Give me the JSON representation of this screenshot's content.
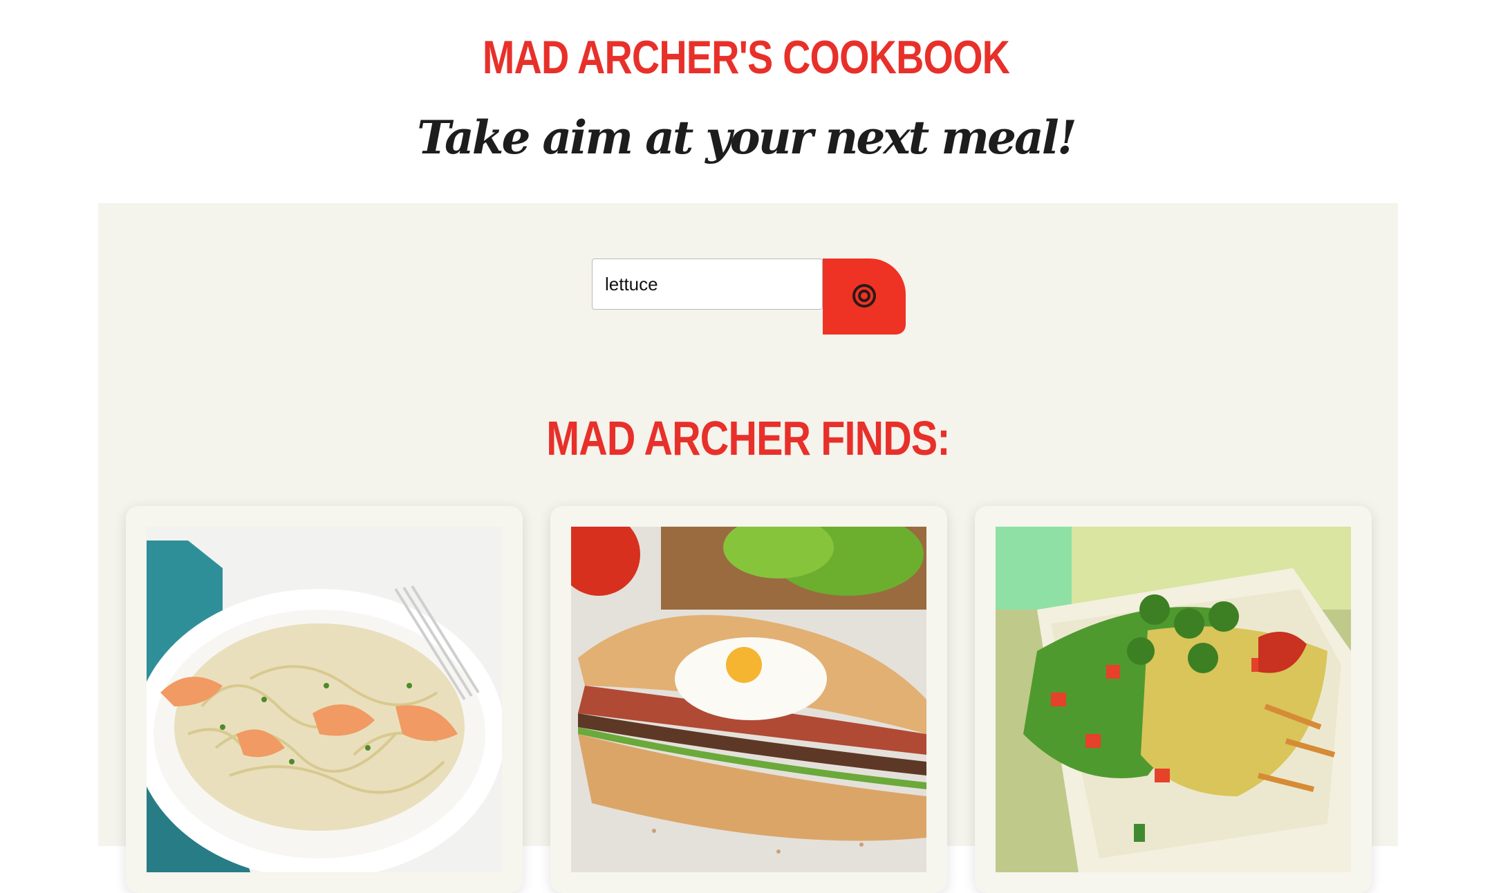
{
  "header": {
    "title": "MAD ARCHER'S COOKBOOK",
    "tagline": "Take aim at your next meal!"
  },
  "search": {
    "value": "lettuce",
    "button_icon": "target-icon"
  },
  "results": {
    "heading": "MAD ARCHER FINDS:",
    "cards": [
      {
        "image": "shrimp-linguine-photo"
      },
      {
        "image": "steak-egg-sandwich-photo"
      },
      {
        "image": "loaded-fries-salad-photo"
      }
    ]
  },
  "colors": {
    "accent_red": "#e8302a",
    "button_red": "#ee3324",
    "panel_bg": "#f4f3ec",
    "text_dark": "#1d1d1d"
  }
}
